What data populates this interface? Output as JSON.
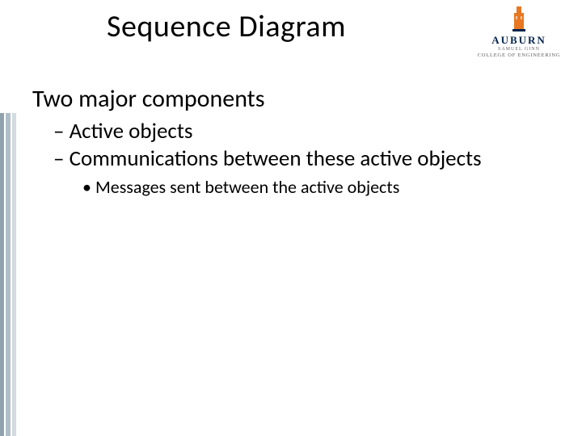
{
  "title": "Sequence Diagram",
  "logo": {
    "university": "AUBURN",
    "unit_line1": "SAMUEL GINN",
    "unit_line2": "COLLEGE OF ENGINEERING"
  },
  "content": {
    "heading": "Two major components",
    "bullets": [
      {
        "text": "Active objects"
      },
      {
        "text": "Communications between these active objects",
        "sub": [
          {
            "text": "Messages sent between the active objects"
          }
        ]
      }
    ]
  }
}
